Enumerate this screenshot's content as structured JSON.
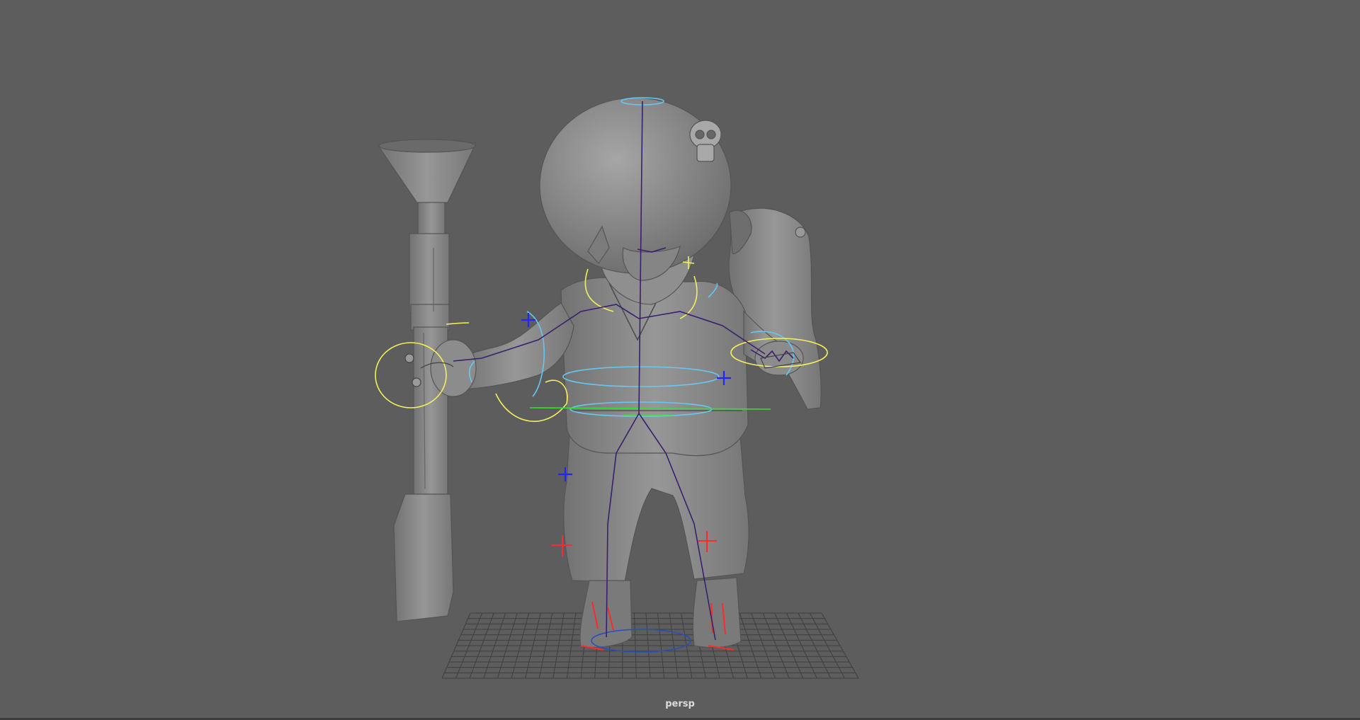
{
  "viewport": {
    "camera_label": "persp",
    "background_color": "#5d5d5d",
    "model_color": "#8a8a8a",
    "grid_color": "#3f3f3f"
  },
  "rig": {
    "fk_control_color": "#f5f05a",
    "ik_control_color": "#66c8f0",
    "joint_color": "#3a1f6e",
    "root_control_color": "#35e035",
    "left_side_locator_color": "#2323ff",
    "right_side_locator_color": "#ff2a2a"
  }
}
